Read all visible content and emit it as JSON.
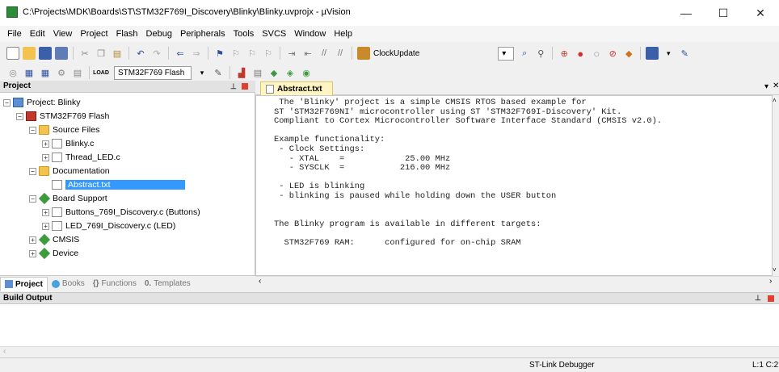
{
  "window": {
    "title": "C:\\Projects\\MDK\\Boards\\ST\\STM32F769I_Discovery\\Blinky\\Blinky.uvprojx - µVision",
    "minimize": "—",
    "maximize": "☐",
    "close": "✕"
  },
  "menu": [
    "File",
    "Edit",
    "View",
    "Project",
    "Flash",
    "Debug",
    "Peripherals",
    "Tools",
    "SVCS",
    "Window",
    "Help"
  ],
  "toolbar": {
    "clock_update": "ClockUpdate",
    "target_select": "STM32F769 Flash",
    "load_label": "LOAD"
  },
  "project_panel": {
    "title": "Project",
    "tree": {
      "root": "Project: Blinky",
      "target": "STM32F769 Flash",
      "source_files": "Source Files",
      "blinky_c": "Blinky.c",
      "thread_led_c": "Thread_LED.c",
      "documentation": "Documentation",
      "abstract_txt": "Abstract.txt",
      "board_support": "Board Support",
      "buttons_c": "Buttons_769I_Discovery.c (Buttons)",
      "led_c": "LED_769I_Discovery.c (LED)",
      "cmsis": "CMSIS",
      "device": "Device"
    },
    "tabs": {
      "project": "Project",
      "books": "Books",
      "functions": "Functions",
      "templates": "Templates"
    }
  },
  "editor": {
    "tab_label": "Abstract.txt",
    "text": " The 'Blinky' project is a simple CMSIS RTOS based example for\nST 'STM32F769NI' microcontroller using ST 'STM32F769I-Discovery' Kit.\nCompliant to Cortex Microcontroller Software Interface Standard (CMSIS v2.0).\n\nExample functionality:\n - Clock Settings:\n   - XTAL    =            25.00 MHz\n   - SYSCLK  =           216.00 MHz\n\n - LED is blinking\n - blinking is paused while holding down the USER button\n\n\nThe Blinky program is available in different targets:\n\n  STM32F769 RAM:      configured for on-chip SRAM"
  },
  "build_output": {
    "title": "Build Output"
  },
  "status_bar": {
    "debugger": "ST-Link Debugger",
    "position": "L:1 C:2"
  },
  "colors": {
    "selection": "#3399ff",
    "editor_tab": "#fff5c2",
    "pane_header": "#e2e2e2"
  }
}
